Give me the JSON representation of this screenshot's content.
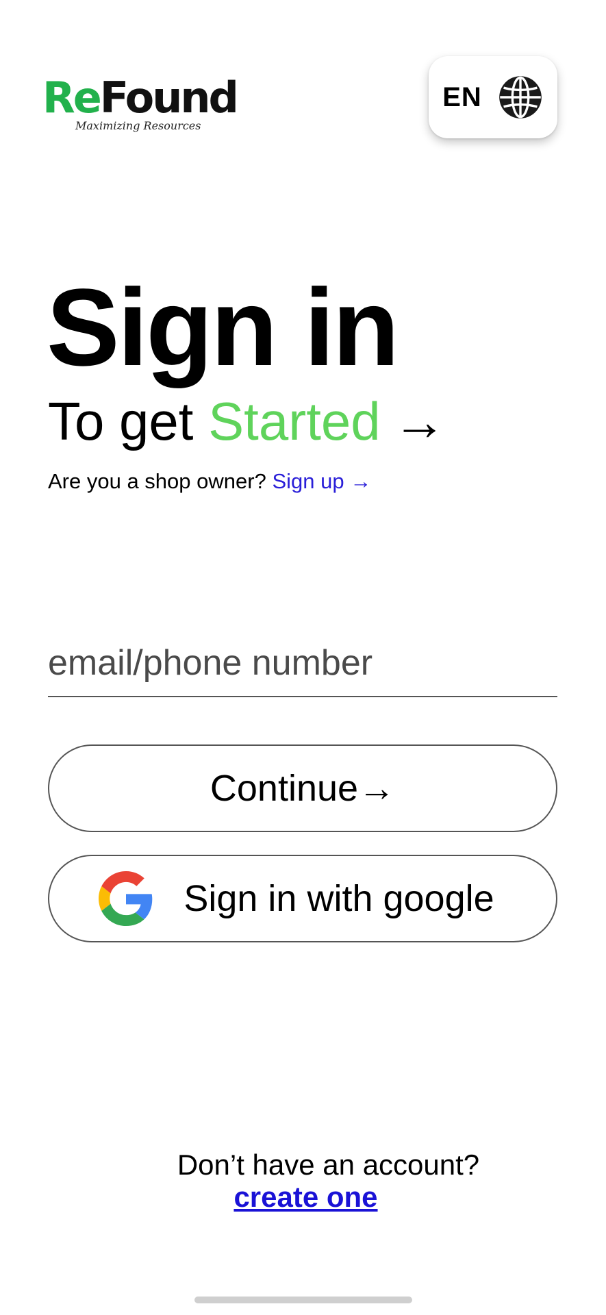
{
  "brand": {
    "name_part1": "Re",
    "name_part2": "Found",
    "tagline": "Maximizing Resources",
    "colors": {
      "green": "#22b14c",
      "dark": "#111111"
    }
  },
  "language_button": {
    "label": "EN",
    "icon": "globe-icon"
  },
  "heading": {
    "title": "Sign in",
    "subtitle_prefix": "To get ",
    "subtitle_accent": "Started",
    "subtitle_arrow": "→",
    "accent_color": "#5fd35b"
  },
  "shop_owner": {
    "question": "Are you a shop owner? ",
    "link_label": "Sign up →",
    "link_color": "#2a1fd8"
  },
  "email_input": {
    "placeholder": "email/phone number",
    "value": ""
  },
  "continue_button": {
    "label": "Continue→"
  },
  "google_button": {
    "label": "Sign in with google",
    "icon": "google-icon"
  },
  "footer": {
    "question": "Don’t have an account?",
    "link_label": "create one",
    "link_color": "#1a12d6"
  }
}
